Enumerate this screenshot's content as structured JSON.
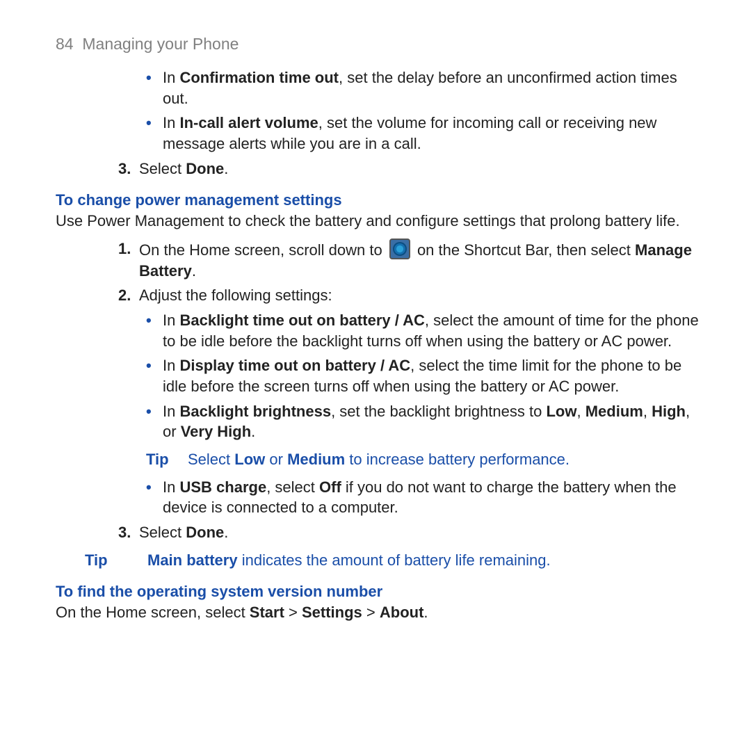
{
  "header": {
    "page_no": "84",
    "title": "Managing your Phone"
  },
  "top_bullets": [
    {
      "pre": "In ",
      "bold": "Confirmation time out",
      "post": ", set the delay before an unconfirmed action times out."
    },
    {
      "pre": "In ",
      "bold": "In-call alert volume",
      "post": ", set the volume for incoming call or receiving new message alerts while you are in a call."
    }
  ],
  "step_top": {
    "num": "3.",
    "pre": "Select ",
    "bold": "Done",
    "post": "."
  },
  "sec1": {
    "heading": "To change power management settings",
    "intro": "Use Power Management to check the battery and configure settings that prolong battery life.",
    "step1": {
      "num": "1.",
      "pre": "On the Home screen, scroll down to ",
      "mid": " on the Shortcut Bar, then select ",
      "bold": "Manage Battery",
      "post": "."
    },
    "step2": {
      "num": "2.",
      "text": "Adjust the following settings:"
    },
    "bullets": [
      {
        "pre": "In ",
        "bold": "Backlight time out on battery / AC",
        "post": ", select the amount of time for the phone to be idle before the backlight turns off when using the battery or AC power."
      },
      {
        "pre": "In ",
        "bold": "Display time out on battery / AC",
        "post": ", select the time limit for the phone to be idle before the screen turns off when using the battery or AC power."
      }
    ],
    "bullet_bright": {
      "pre": "In ",
      "b1": "Backlight brightness",
      "mid1": ", set the backlight brightness to ",
      "b2": "Low",
      "sep1": ", ",
      "b3": "Medium",
      "sep2": ", ",
      "b4": "High",
      "sep3": ", or ",
      "b5": "Very High",
      "post": "."
    },
    "tip_inner": {
      "label": "Tip",
      "pre": "Select ",
      "b1": "Low",
      "mid": " or ",
      "b2": "Medium",
      "post": " to increase battery performance."
    },
    "bullet_usb": {
      "pre": "In ",
      "b1": "USB charge",
      "mid": ", select ",
      "b2": "Off",
      "post": " if you do not want to charge the battery when the device is connected to a computer."
    },
    "step3": {
      "num": "3.",
      "pre": "Select ",
      "bold": "Done",
      "post": "."
    },
    "tip_outer": {
      "label": "Tip",
      "b1": "Main battery",
      "post": " indicates the amount of battery life remaining."
    }
  },
  "sec2": {
    "heading": "To find the operating system version number",
    "line": {
      "pre": "On the Home screen, select ",
      "b1": "Start",
      "g1": " > ",
      "b2": "Settings",
      "g2": " > ",
      "b3": "About",
      "post": "."
    }
  }
}
